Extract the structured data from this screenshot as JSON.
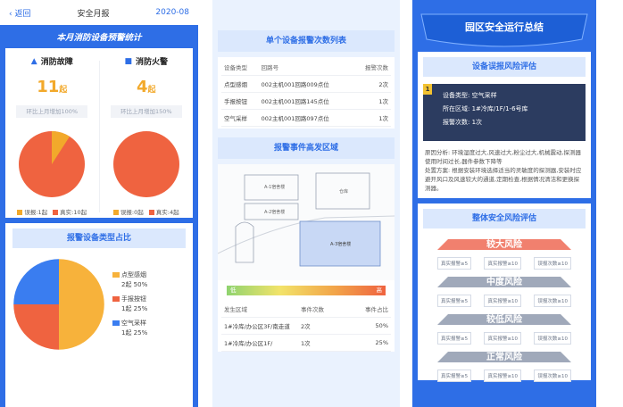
{
  "p1": {
    "back": "返回",
    "title": "安全月报",
    "date": "2020-08",
    "banner": "本月消防设备预警统计",
    "left": {
      "name": "消防故障",
      "count": "11",
      "unit": "起",
      "compare": "环比上月增加100%",
      "legend": [
        {
          "label": "误报:1起",
          "color": "#f2a92b"
        },
        {
          "label": "真实:10起",
          "color": "#ef6340"
        }
      ],
      "pie": [
        1,
        10
      ]
    },
    "right": {
      "name": "消防火警",
      "count": "4",
      "unit": "起",
      "compare": "环比上月增加150%",
      "legend": [
        {
          "label": "误报:0起",
          "color": "#f2a92b"
        },
        {
          "label": "真实:4起",
          "color": "#ef6340"
        }
      ],
      "pie": [
        0,
        4
      ]
    },
    "section2": "报警设备类型占比",
    "pie2": [
      {
        "label": "点型感烟",
        "value": "2起 50%",
        "pct": 50,
        "color": "#f7b23b"
      },
      {
        "label": "手报按钮",
        "value": "1起 25%",
        "pct": 25,
        "color": "#ef6340"
      },
      {
        "label": "空气采样",
        "value": "1起 25%",
        "pct": 25,
        "color": "#3a7df0"
      }
    ]
  },
  "p2": {
    "header": "单个设备报警次数列表",
    "cols": [
      "设备类型",
      "回路号",
      "报警次数"
    ],
    "rows": [
      [
        "点型感烟",
        "002主机001回路009点位",
        "2次"
      ],
      [
        "手报按钮",
        "002主机001回路145点位",
        "1次"
      ],
      [
        "空气采样",
        "002主机001回路097点位",
        "1次"
      ]
    ],
    "section2": "报警事件高发区域",
    "map": {
      "a1": "A-1宿舍楼",
      "a2": "A-2宿舍楼",
      "b": "仓库",
      "a3": "A-3宿舍楼"
    },
    "low": "低",
    "high": "高",
    "cols2": [
      "发生区域",
      "事件次数",
      "事件占比"
    ],
    "rows2": [
      [
        "1#冷库/办公区3F/南走道",
        "2次",
        "50%"
      ],
      [
        "1#冷库/办公区1F/",
        "1次",
        "25%"
      ]
    ]
  },
  "p3": {
    "banner": "园区安全运行总结",
    "sub1": "设备误报风险评估",
    "badge": "1",
    "info": [
      "设备类型: 空气采样",
      "所在区域: 1#冷库/1F/1-6号库",
      "报警次数: 1次"
    ],
    "analysis": "原因分析: 环境湿度过大,风速过大,粉尘过大,机械震动,探测器使用时间过长,器件参数下降等\n处置方案: 根据安装环境选择适当的灵敏度的探测器,安装时应避开风口及风速较大的通道,定期检查,根据情况清洁和更换探测器。",
    "sub2": "整体安全风险评估",
    "levels": [
      {
        "label": "较大风险",
        "color": "#ef6a55"
      },
      {
        "label": "中度风险",
        "color": "#8f9aae"
      },
      {
        "label": "较低风险",
        "color": "#8f9aae"
      },
      {
        "label": "正常风险",
        "color": "#8f9aae"
      }
    ],
    "chips": [
      "真实报警≥5",
      "真实报警≥10",
      "误报次数≥10"
    ]
  },
  "colors": {
    "brand": "#2e6ee6",
    "orange": "#f2a92b",
    "red": "#ef6340"
  }
}
